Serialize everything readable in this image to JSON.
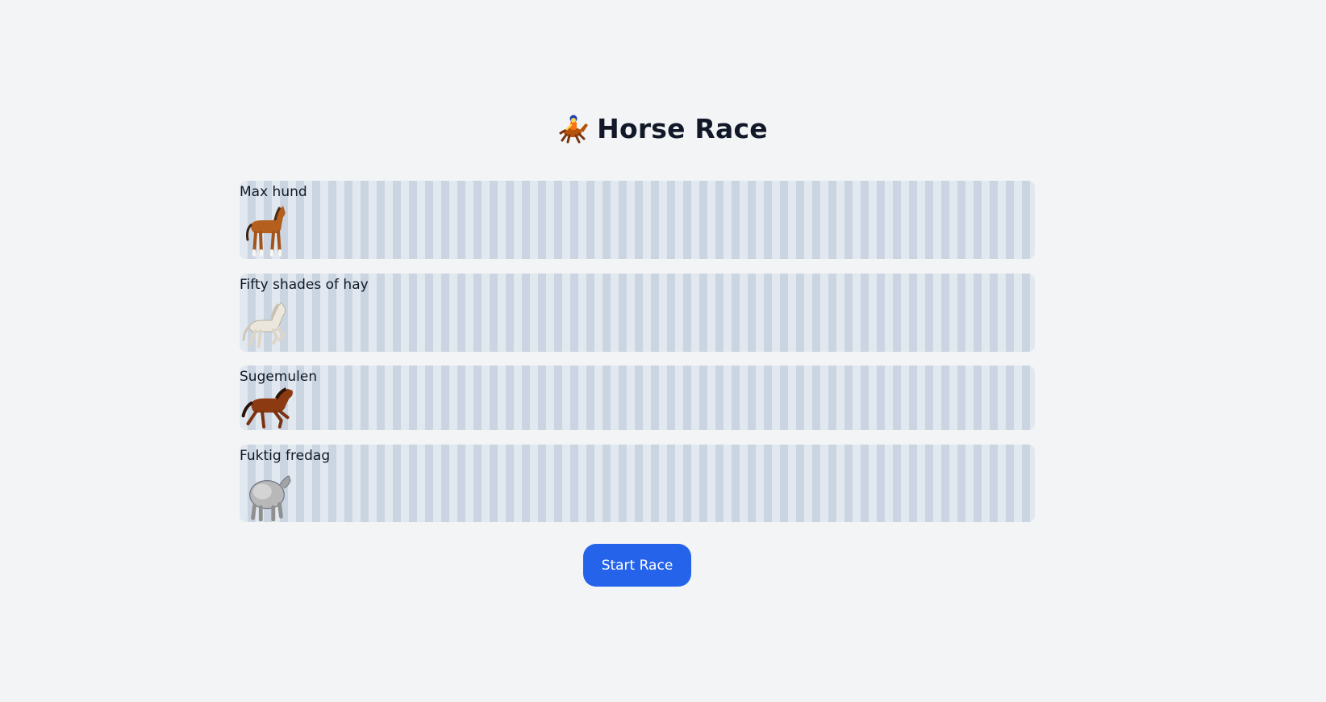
{
  "header": {
    "icon": "horse-racing-emoji",
    "title": "Horse Race"
  },
  "race": {
    "horses": [
      {
        "name": "Max hund",
        "icon": "brown-horse-icon",
        "progress": 0
      },
      {
        "name": "Fifty shades of hay",
        "icon": "white-horse-icon",
        "progress": 0
      },
      {
        "name": "Sugemulen",
        "icon": "chestnut-horse-icon",
        "progress": 0
      },
      {
        "name": "Fuktig fredag",
        "icon": "grey-pony-icon",
        "progress": 0
      }
    ]
  },
  "controls": {
    "start_label": "Start Race"
  },
  "colors": {
    "background": "#f3f4f6",
    "track_light": "#e2e8f0",
    "track_dark": "#cbd5e1",
    "button": "#2563eb"
  }
}
